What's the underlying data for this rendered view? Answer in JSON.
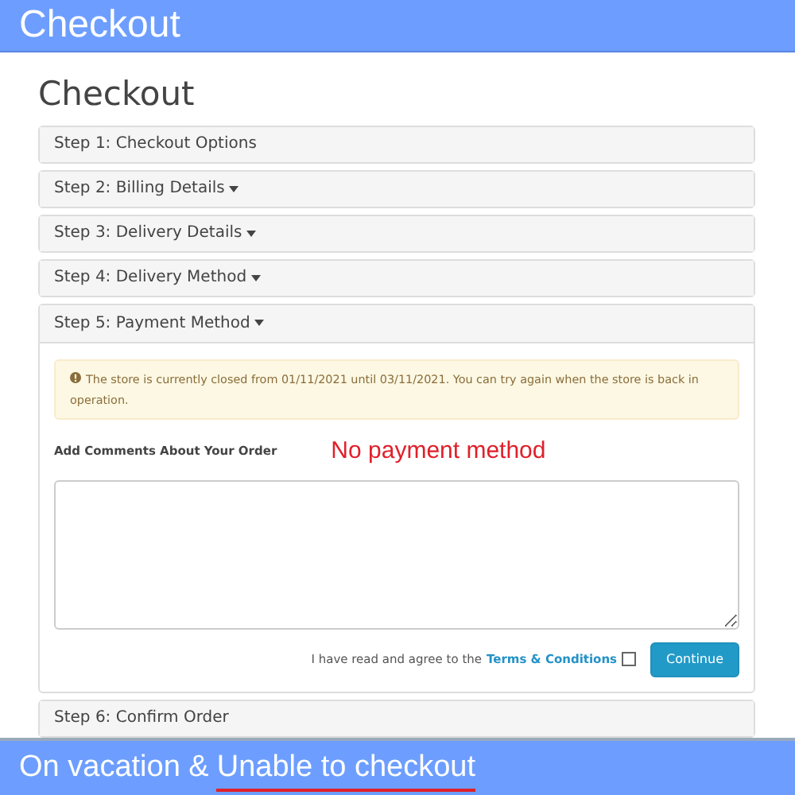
{
  "banner": {
    "title": "Checkout"
  },
  "page": {
    "heading": "Checkout"
  },
  "steps": [
    {
      "label": "Step 1: Checkout Options",
      "caret": false,
      "expanded": false
    },
    {
      "label": "Step 2: Billing Details",
      "caret": true,
      "expanded": false
    },
    {
      "label": "Step 3: Delivery Details",
      "caret": true,
      "expanded": false
    },
    {
      "label": "Step 4: Delivery Method",
      "caret": true,
      "expanded": false
    },
    {
      "label": "Step 5: Payment Method",
      "caret": true,
      "expanded": true
    },
    {
      "label": "Step 6: Confirm Order",
      "caret": false,
      "expanded": false
    }
  ],
  "payment": {
    "alert": "The store is currently closed from 01/11/2021 until 03/11/2021. You can try again when the store is back in operation.",
    "comments_label": "Add Comments About Your Order",
    "annotation": "No payment method",
    "agree_text": "I have read and agree to the",
    "terms_link": "Terms & Conditions",
    "agree_checked": false,
    "continue_button": "Continue"
  },
  "footer": {
    "prefix": "On vacation &",
    "emphasis": "Unable to checkout"
  }
}
